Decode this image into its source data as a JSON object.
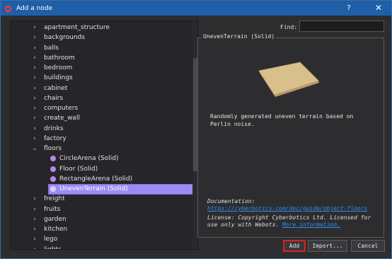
{
  "window": {
    "title": "Add a node",
    "help_label": "?",
    "close_label": "✕"
  },
  "tree": {
    "items": [
      {
        "label": "apartment_structure",
        "chevron": "›",
        "level": 0
      },
      {
        "label": "backgrounds",
        "chevron": "›",
        "level": 0
      },
      {
        "label": "balls",
        "chevron": "›",
        "level": 0
      },
      {
        "label": "bathroom",
        "chevron": "›",
        "level": 0
      },
      {
        "label": "bedroom",
        "chevron": "›",
        "level": 0
      },
      {
        "label": "buildings",
        "chevron": "›",
        "level": 0
      },
      {
        "label": "cabinet",
        "chevron": "›",
        "level": 0
      },
      {
        "label": "chairs",
        "chevron": "›",
        "level": 0
      },
      {
        "label": "computers",
        "chevron": "›",
        "level": 0
      },
      {
        "label": "create_wall",
        "chevron": "›",
        "level": 0
      },
      {
        "label": "drinks",
        "chevron": "›",
        "level": 0
      },
      {
        "label": "factory",
        "chevron": "›",
        "level": 0
      },
      {
        "label": "floors",
        "chevron": "⌄",
        "level": 0
      },
      {
        "label": "CircleArena (Solid)",
        "chevron": "",
        "level": 1
      },
      {
        "label": "Floor (Solid)",
        "chevron": "",
        "level": 1
      },
      {
        "label": "RectangleArena (Solid)",
        "chevron": "",
        "level": 1
      },
      {
        "label": "UnevenTerrain (Solid)",
        "chevron": "",
        "level": 1,
        "selected": true
      },
      {
        "label": "freight",
        "chevron": "›",
        "level": 0
      },
      {
        "label": "fruits",
        "chevron": "›",
        "level": 0
      },
      {
        "label": "garden",
        "chevron": "›",
        "level": 0
      },
      {
        "label": "kitchen",
        "chevron": "›",
        "level": 0
      },
      {
        "label": "lego",
        "chevron": "›",
        "level": 0
      },
      {
        "label": "lights",
        "chevron": "›",
        "level": 0
      }
    ]
  },
  "find": {
    "label": "Find:",
    "value": ""
  },
  "info": {
    "group_title": "UnevenTerrain (Solid)",
    "description": "Randomly generated uneven terrain based on Perlin noise.",
    "doc_prefix": "Documentation: ",
    "doc_link": "https://cyberbotics.com/doc/guide/object-floors",
    "license_prefix": "License: Copyright Cyberbotics Ltd. Licensed for use only with Webots. ",
    "license_link": "More information."
  },
  "buttons": {
    "add": "Add",
    "import": "Import...",
    "cancel": "Cancel"
  },
  "colors": {
    "titlebar": "#1f5fa8",
    "selection": "#9b8cf2",
    "node_dot": "#b58ae6",
    "link": "#2f8ef0",
    "highlight_border": "#e02020"
  }
}
